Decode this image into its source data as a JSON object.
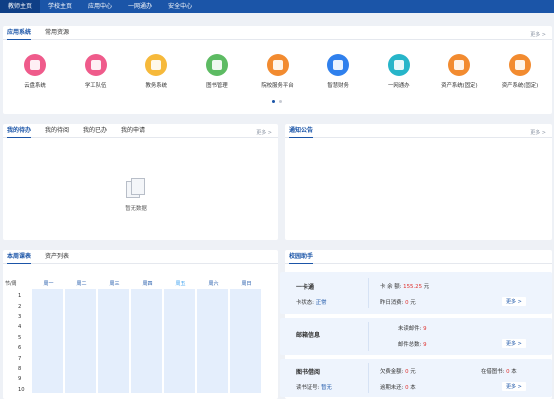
{
  "topnav": {
    "items": [
      {
        "label": "教师主页"
      },
      {
        "label": "学校主页"
      },
      {
        "label": "应用中心"
      },
      {
        "label": "一网通办"
      },
      {
        "label": "安全中心"
      }
    ]
  },
  "apps_panel": {
    "tabs": [
      {
        "label": "应用系统"
      },
      {
        "label": "常用资源"
      }
    ],
    "more": "更多 >",
    "apps": [
      {
        "label": "云盘系统",
        "color": "#ef5b8b"
      },
      {
        "label": "学工队伍",
        "color": "#ef5b8b"
      },
      {
        "label": "教务系统",
        "color": "#f6b93b"
      },
      {
        "label": "图书管理",
        "color": "#5dbb63"
      },
      {
        "label": "院校服务平台",
        "color": "#f28b30"
      },
      {
        "label": "智慧财务",
        "color": "#2f80ed"
      },
      {
        "label": "一网通办",
        "color": "#27b5c9"
      },
      {
        "label": "资产系统(固定)",
        "color": "#f28b30"
      },
      {
        "label": "资产系统(固定)",
        "color": "#f28b30"
      }
    ]
  },
  "tasks_panel": {
    "tabs": [
      {
        "label": "我的待办"
      },
      {
        "label": "我的待阅"
      },
      {
        "label": "我的已办"
      },
      {
        "label": "我的申请"
      }
    ],
    "more": "更多 >",
    "empty": "暂无数据"
  },
  "notice_panel": {
    "title": "通知公告",
    "more": "更多 >"
  },
  "schedule_panel": {
    "tabs": [
      {
        "label": "本周课表"
      },
      {
        "label": "资产列表"
      }
    ],
    "corner": "节/周",
    "days": [
      "周一",
      "周二",
      "周三",
      "周四",
      "周五",
      "周六",
      "周日"
    ],
    "periods": [
      "1",
      "2",
      "3",
      "4",
      "5",
      "6",
      "7",
      "8",
      "9",
      "10"
    ]
  },
  "campus_panel": {
    "title": "校园助手",
    "card1": {
      "title": "一卡通",
      "status_label": "卡状态:",
      "status_value": "正常",
      "balance_label": "卡 余 额:",
      "balance_value": "155.25",
      "balance_unit": "元",
      "yesterday_label": "昨日消费:",
      "yesterday_value": "0",
      "yesterday_unit": "元",
      "more": "更多 >"
    },
    "card2": {
      "title": "邮箱信息",
      "unread_label": "未读邮件:",
      "unread_value": "9",
      "total_label": "邮件总数:",
      "total_value": "9",
      "more": "更多 >"
    },
    "card3": {
      "title": "图书借阅",
      "reader_label": "读书证号:",
      "reader_value": "暂无",
      "arrears_label": "欠费金额:",
      "arrears_value": "0",
      "arrears_unit": "元",
      "borrowed_label": "在借图书:",
      "borrowed_value": "0",
      "borrowed_unit": "本",
      "overdue_label": "逾期未还:",
      "overdue_value": "0",
      "overdue_unit": "本",
      "more": "更多 >"
    }
  }
}
